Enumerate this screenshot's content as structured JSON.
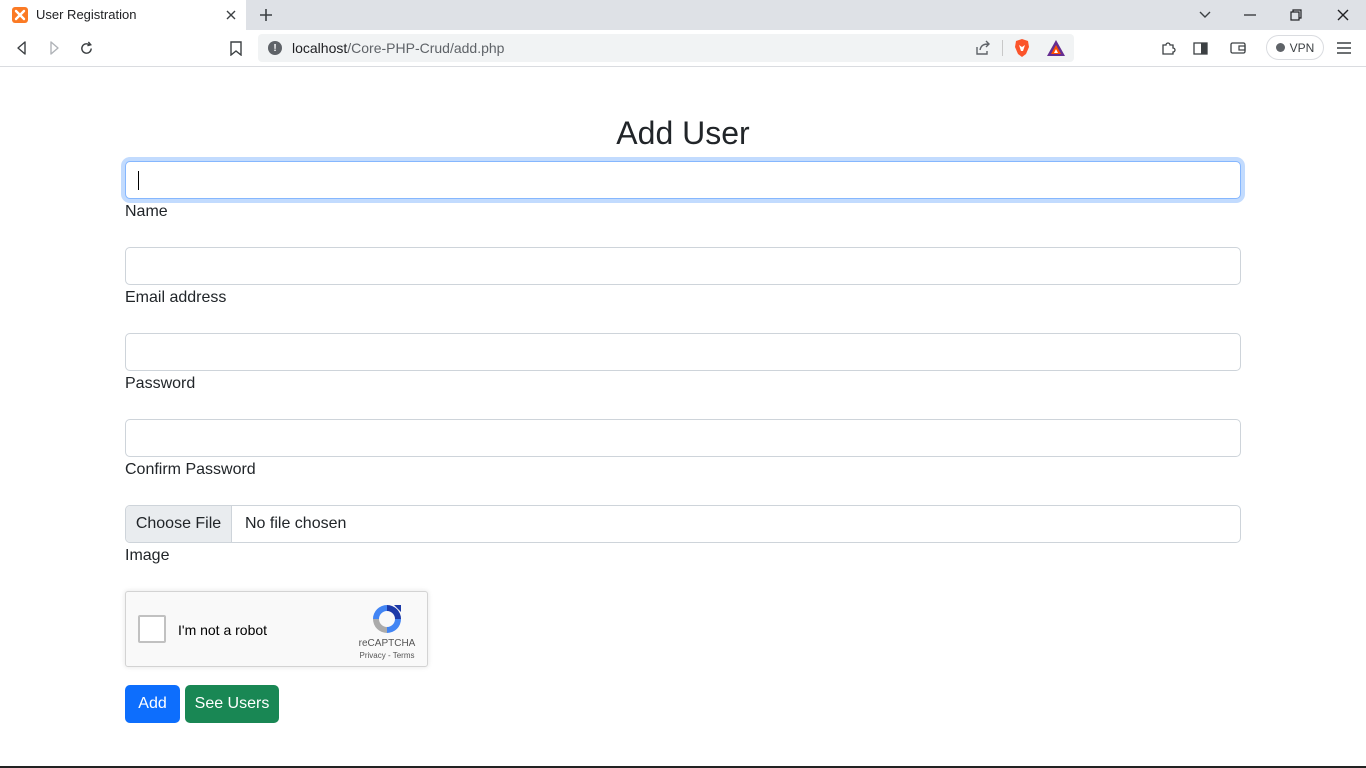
{
  "browser": {
    "tab_title": "User Registration",
    "url_host": "localhost",
    "url_path": "/Core-PHP-Crud/add.php",
    "vpn_label": "VPN"
  },
  "page": {
    "title": "Add User",
    "fields": {
      "name_label": "Name",
      "email_label": "Email address",
      "password_label": "Password",
      "confirm_label": "Confirm Password",
      "image_label": "Image"
    },
    "file": {
      "button_label": "Choose File",
      "status": "No file chosen"
    },
    "captcha": {
      "label": "I'm not a robot",
      "brand": "reCAPTCHA",
      "links": "Privacy - Terms"
    },
    "buttons": {
      "add": "Add",
      "see_users": "See Users"
    }
  },
  "colors": {
    "primary": "#0d6efd",
    "success": "#198754",
    "focus_ring": "#86b7fe"
  }
}
